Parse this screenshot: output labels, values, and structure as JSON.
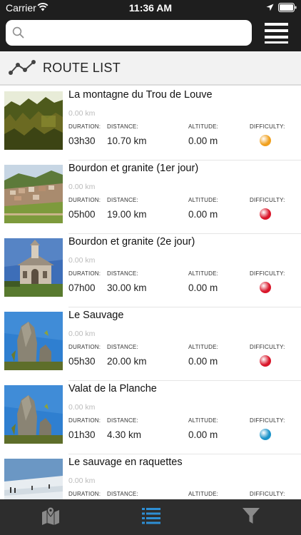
{
  "status_bar": {
    "carrier": "Carrier",
    "time": "11:36 AM"
  },
  "search": {
    "placeholder": "",
    "value": ""
  },
  "section": {
    "title": "ROUTE LIST",
    "icon": "route-icon"
  },
  "labels": {
    "duration": "DURATION:",
    "distance": "DISTANCE:",
    "altitude": "ALTITUDE:",
    "difficulty": "DIFFICULTY:"
  },
  "colors": {
    "header": "#1e1e1e",
    "tabbar": "#2d2d2d",
    "tab_active": "#2e8fd4",
    "tab_inactive": "#8a8a8a",
    "orange": "#f0a01e",
    "red": "#d9162a",
    "blue": "#1c93c9"
  },
  "routes": [
    {
      "title": "La montagne du Trou de Louve",
      "distance_top": "0.00 km",
      "duration": "03h30",
      "distance": "10.70 km",
      "altitude": "0.00 m",
      "difficulty_color": "#f0a01e",
      "image": "forest"
    },
    {
      "title": "Bourdon et granite (1er jour)",
      "distance_top": "0.00 km",
      "duration": "05h00",
      "distance": "19.00 km",
      "altitude": "0.00 m",
      "difficulty_color": "#d9162a",
      "image": "village"
    },
    {
      "title": "Bourdon et granite (2e jour)",
      "distance_top": "0.00 km",
      "duration": "07h00",
      "distance": "30.00 km",
      "altitude": "0.00 m",
      "difficulty_color": "#d9162a",
      "image": "church"
    },
    {
      "title": "Le Sauvage",
      "distance_top": "0.00 km",
      "duration": "05h30",
      "distance": "20.00 km",
      "altitude": "0.00 m",
      "difficulty_color": "#d9162a",
      "image": "rock"
    },
    {
      "title": "Valat de la Planche",
      "distance_top": "0.00 km",
      "duration": "01h30",
      "distance": "4.30 km",
      "altitude": "0.00 m",
      "difficulty_color": "#1c93c9",
      "image": "rock"
    },
    {
      "title": "Le sauvage en raquettes",
      "distance_top": "0.00 km",
      "duration": "",
      "distance": "",
      "altitude": "",
      "difficulty_color": "",
      "image": "snow"
    }
  ],
  "tabbar": [
    {
      "name": "map",
      "icon": "map-pin-icon",
      "active": false
    },
    {
      "name": "list",
      "icon": "list-icon",
      "active": true
    },
    {
      "name": "filter",
      "icon": "filter-icon",
      "active": false
    }
  ]
}
